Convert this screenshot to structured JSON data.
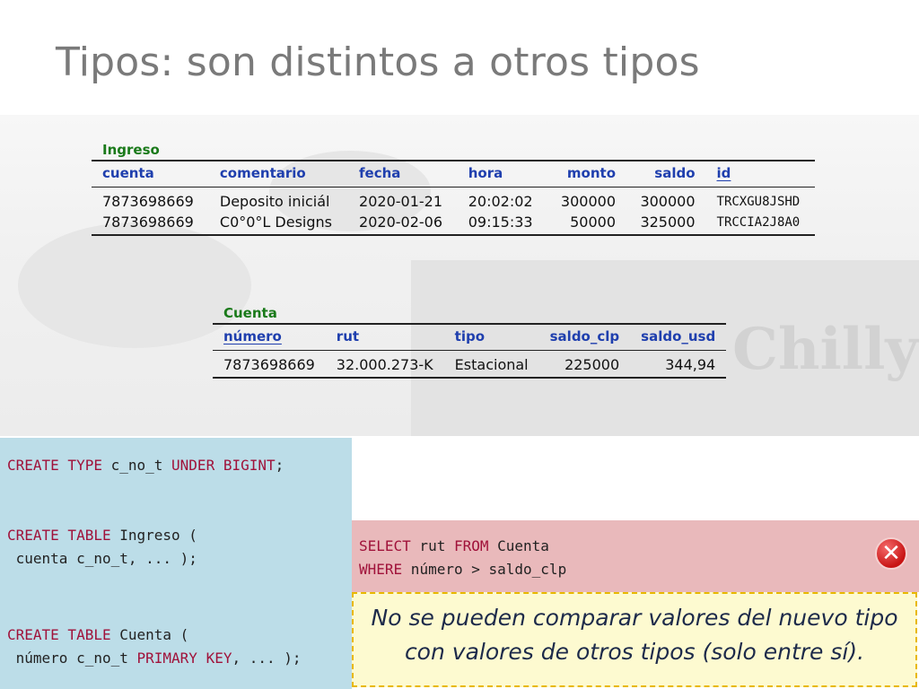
{
  "slide": {
    "title": "Tipos: son distintos a otros tipos"
  },
  "ingreso": {
    "caption": "Ingreso",
    "headers": [
      "cuenta",
      "comentario",
      "fecha",
      "hora",
      "monto",
      "saldo",
      "id"
    ],
    "rows": [
      [
        "7873698669",
        "Deposito iniciál",
        "2020-01-21",
        "20:02:02",
        "300000",
        "300000",
        "TRCXGU8JSHD"
      ],
      [
        "7873698669",
        "C0°0°L Designs",
        "2020-02-06",
        "09:15:33",
        "50000",
        "325000",
        "TRCCIA2J8A0"
      ]
    ]
  },
  "cuenta": {
    "caption": "Cuenta",
    "headers": [
      "número",
      "rut",
      "tipo",
      "saldo_clp",
      "saldo_usd"
    ],
    "rows": [
      [
        "7873698669",
        "32.000.273-K",
        "Estacional",
        "225000",
        "344,94"
      ]
    ]
  },
  "code": {
    "stmt1": {
      "kw1": "CREATE TYPE",
      "rest1": " c_no_t ",
      "kw2": "UNDER BIGINT",
      "rest2": ";"
    },
    "stmt2": {
      "kw1": "CREATE TABLE",
      "rest1": " Ingreso (",
      "line2": " cuenta c_no_t, ... );"
    },
    "stmt3": {
      "kw1": "CREATE TABLE",
      "rest1": " Cuenta (",
      "line2a": " número c_no_t ",
      "kw2": "PRIMARY KEY",
      "line2b": ", ... );"
    }
  },
  "query": {
    "kw1": "SELECT",
    "rest1": " rut ",
    "kw2": "FROM",
    "rest2": " Cuenta",
    "kw3": "WHERE",
    "rest3": " número > saldo_clp"
  },
  "error_icon": "error-x-icon",
  "note": {
    "line1": "No se pueden comparar valores del nuevo tipo",
    "line2": "con valores de otros tipos (solo entre sí)."
  }
}
